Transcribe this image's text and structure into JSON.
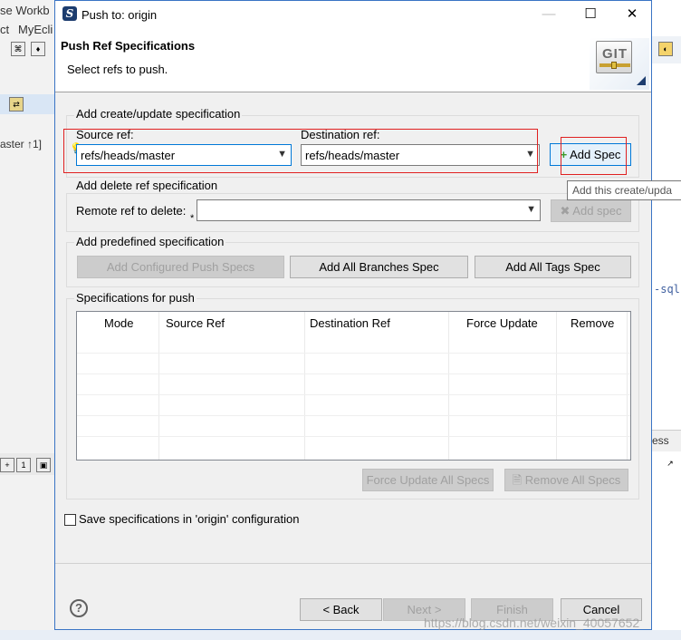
{
  "background": {
    "top_left_texts": [
      "se Workb",
      "ct",
      "MyEcli"
    ],
    "branch_text": "aster ↑1]",
    "right_code": "-sql:",
    "right_tab": "ess"
  },
  "dialog": {
    "title": "Push to: origin",
    "header_title": "Push Ref Specifications",
    "header_desc": "Select refs to push.",
    "logo_text": "GIT",
    "add_create": {
      "group_label": "Add create/update specification",
      "source_label": "Source ref:",
      "source_value": "refs/heads/master",
      "dest_label": "Destination ref:",
      "dest_value": "refs/heads/master",
      "add_button": "Add Spec"
    },
    "add_delete": {
      "group_label": "Add delete ref specification",
      "remote_label": "Remote ref to delete:",
      "remote_value": "",
      "add_button": "Add spec"
    },
    "predefined": {
      "group_label": "Add predefined specification",
      "buttons": [
        "Add Configured Push Specs",
        "Add All Branches Spec",
        "Add All Tags Spec"
      ]
    },
    "specs": {
      "group_label": "Specifications for push",
      "columns": [
        "Mode",
        "Source Ref",
        "Destination Ref",
        "Force Update",
        "Remove"
      ],
      "force_all": "Force Update All Specs",
      "remove_all": "Remove All Specs"
    },
    "save_checkbox_label": "Save specifications in 'origin' configuration",
    "tooltip": "Add this create/upda",
    "buttons": {
      "back": "< Back",
      "next": "Next >",
      "finish": "Finish",
      "cancel": "Cancel"
    }
  },
  "watermark": "https://blog.csdn.net/weixin_40057652"
}
